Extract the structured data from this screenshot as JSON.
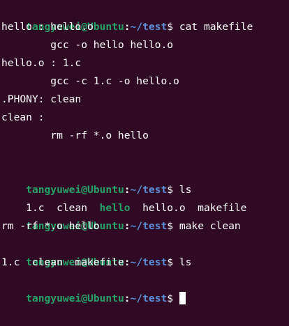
{
  "prompt": {
    "user_host": "tangyuwei@Ubuntu",
    "colon": ":",
    "path": "~/test",
    "dollar": "$ "
  },
  "session": {
    "cmd1": "cat makefile",
    "makefile_lines": [
      "hello : hello.o",
      "        gcc -o hello hello.o",
      "hello.o : 1.c",
      "        gcc -c 1.c -o hello.o",
      ".PHONY: clean",
      "clean :",
      "        rm -rf *.o hello",
      ""
    ],
    "cmd2": "ls",
    "ls1": {
      "pre": "1.c  clean  ",
      "exec": "hello",
      "post": "  hello.o  makefile"
    },
    "cmd3": "make clean",
    "make_output": "rm -rf *.o hello",
    "cmd4": "ls",
    "ls2": "1.c  clean  makefile"
  },
  "colors": {
    "background": "#300a24",
    "prompt_user": "#26a269",
    "prompt_path": "#5b8fd9",
    "text": "#ffffff"
  }
}
